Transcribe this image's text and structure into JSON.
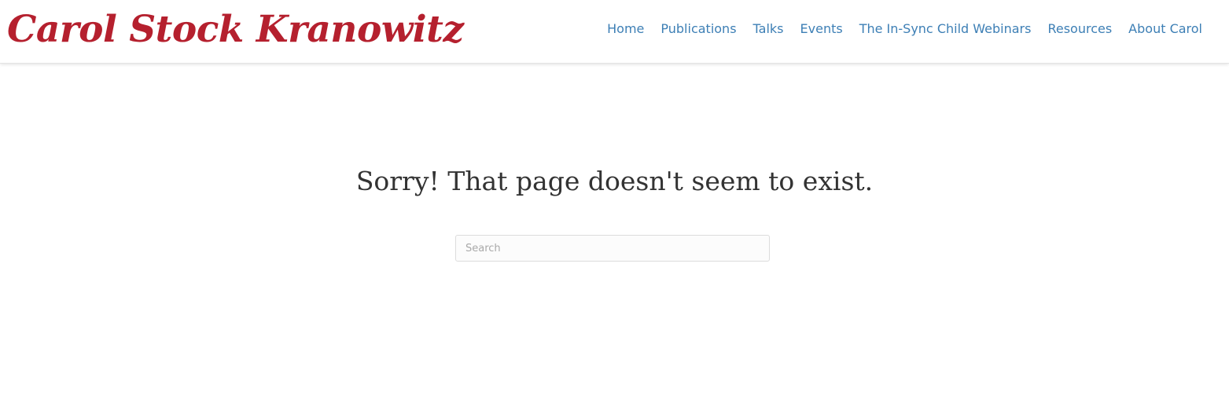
{
  "header": {
    "logo_text": "Carol Stock Kranowitz",
    "nav": [
      {
        "label": "Home"
      },
      {
        "label": "Publications"
      },
      {
        "label": "Talks"
      },
      {
        "label": "Events"
      },
      {
        "label": "The In-Sync Child Webinars"
      },
      {
        "label": "Resources"
      },
      {
        "label": "About Carol"
      }
    ]
  },
  "main": {
    "heading": "Sorry! That page doesn't seem to exist.",
    "search": {
      "value": "",
      "placeholder": "Search"
    }
  },
  "colors": {
    "brand": "#b5202e",
    "link": "#3d7fb5",
    "heading": "#333333"
  }
}
